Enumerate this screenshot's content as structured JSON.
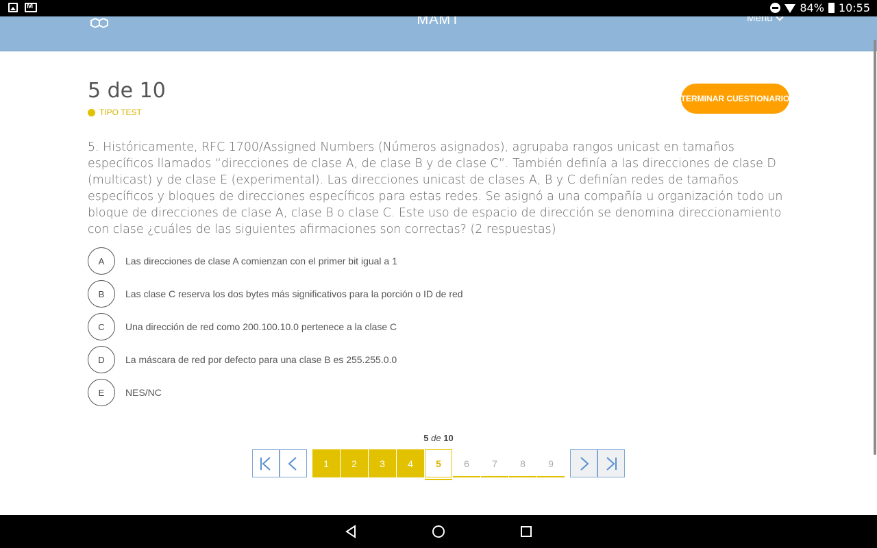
{
  "status_bar": {
    "battery": "84%",
    "time": "10:55",
    "icons": [
      "image-icon",
      "gmail-icon",
      "dnd-icon",
      "wifi-icon",
      "battery-icon"
    ]
  },
  "header": {
    "title": "MAMT",
    "menu_label": "Menu",
    "logo_icon": "molecule-logo-icon",
    "bg_color": "#8fb6d8"
  },
  "quiz": {
    "progress_title": "5 de 10",
    "type_label": "TIPO TEST",
    "finish_label": "TERMINAR CUESTIONARIO",
    "accent_color": "#e2c200",
    "finish_color": "#ffa000",
    "question": "5. Históricamente, RFC 1700/Assigned Numbers (Números asignados), agrupaba rangos unicast en tamaños específicos llamados “direcciones de clase A, de clase B y de clase C”. También definía a las direcciones de clase D (multicast) y de clase E (experimental). Las direcciones unicast de clases A, B y C definían redes de tamaños específicos y bloques de direcciones específicos para estas redes. Se asignó a una compañía u organización todo un bloque de direcciones de clase A, clase B o clase C. Este uso de espacio de dirección se denomina direccionamiento con clase ¿cuáles de las siguientes afirmaciones son correctas? (2 respuestas)",
    "options": [
      {
        "letter": "A",
        "text": "Las direcciones de clase A comienzan con el primer bit igual a 1"
      },
      {
        "letter": "B",
        "text": "Las clase C reserva los dos bytes más significativos para la porción o ID de red"
      },
      {
        "letter": "C",
        "text": "Una dirección de red como 200.100.10.0 pertenece a la clase C"
      },
      {
        "letter": "D",
        "text": "La máscara de red por defecto para una clase B es 255.255.0.0"
      },
      {
        "letter": "E",
        "text": "NES/NC"
      }
    ]
  },
  "pagination": {
    "current": "5",
    "of_word": "de",
    "total": "10",
    "pages": [
      "1",
      "2",
      "3",
      "4",
      "5",
      "6",
      "7",
      "8",
      "9"
    ],
    "completed": 4
  }
}
